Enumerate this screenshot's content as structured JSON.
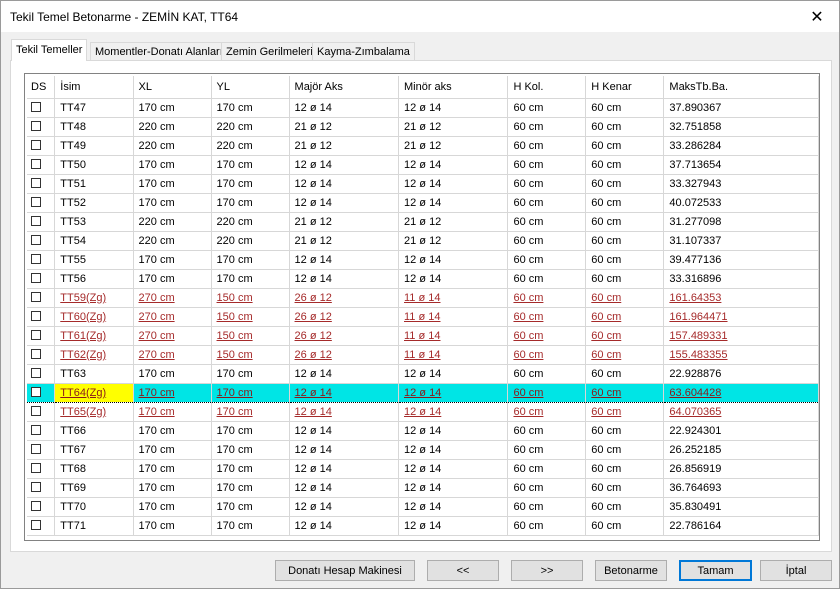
{
  "window": {
    "title": "Tekil Temel Betonarme - ZEMİN KAT, TT64",
    "close_glyph": "✕"
  },
  "tabs": [
    {
      "label": "Tekil Temeller"
    },
    {
      "label": "Momentler-Donatı Alanları"
    },
    {
      "label": "Zemin Gerilmeleri"
    },
    {
      "label": "Kayma-Zımbalama"
    }
  ],
  "table": {
    "columns": [
      "DS",
      "İsim",
      "XL",
      "YL",
      "Majör Aks",
      "Minör aks",
      "H Kol.",
      "H Kenar",
      "MaksTb.Ba."
    ],
    "rows": [
      {
        "name": "TT47",
        "xl": "170 cm",
        "yl": "170 cm",
        "major": "12 ø 14",
        "minor": "12 ø 14",
        "hkol": "60 cm",
        "hkenar": "60 cm",
        "maks": "37.890367"
      },
      {
        "name": "TT48",
        "xl": "220 cm",
        "yl": "220 cm",
        "major": "21 ø 12",
        "minor": "21 ø 12",
        "hkol": "60 cm",
        "hkenar": "60 cm",
        "maks": "32.751858"
      },
      {
        "name": "TT49",
        "xl": "220 cm",
        "yl": "220 cm",
        "major": "21 ø 12",
        "minor": "21 ø 12",
        "hkol": "60 cm",
        "hkenar": "60 cm",
        "maks": "33.286284"
      },
      {
        "name": "TT50",
        "xl": "170 cm",
        "yl": "170 cm",
        "major": "12 ø 14",
        "minor": "12 ø 14",
        "hkol": "60 cm",
        "hkenar": "60 cm",
        "maks": "37.713654"
      },
      {
        "name": "TT51",
        "xl": "170 cm",
        "yl": "170 cm",
        "major": "12 ø 14",
        "minor": "12 ø 14",
        "hkol": "60 cm",
        "hkenar": "60 cm",
        "maks": "33.327943"
      },
      {
        "name": "TT52",
        "xl": "170 cm",
        "yl": "170 cm",
        "major": "12 ø 14",
        "minor": "12 ø 14",
        "hkol": "60 cm",
        "hkenar": "60 cm",
        "maks": "40.072533"
      },
      {
        "name": "TT53",
        "xl": "220 cm",
        "yl": "220 cm",
        "major": "21 ø 12",
        "minor": "21 ø 12",
        "hkol": "60 cm",
        "hkenar": "60 cm",
        "maks": "31.277098"
      },
      {
        "name": "TT54",
        "xl": "220 cm",
        "yl": "220 cm",
        "major": "21 ø 12",
        "minor": "21 ø 12",
        "hkol": "60 cm",
        "hkenar": "60 cm",
        "maks": "31.107337"
      },
      {
        "name": "TT55",
        "xl": "170 cm",
        "yl": "170 cm",
        "major": "12 ø 14",
        "minor": "12 ø 14",
        "hkol": "60 cm",
        "hkenar": "60 cm",
        "maks": "39.477136"
      },
      {
        "name": "TT56",
        "xl": "170 cm",
        "yl": "170 cm",
        "major": "12 ø 14",
        "minor": "12 ø 14",
        "hkol": "60 cm",
        "hkenar": "60 cm",
        "maks": "33.316896"
      },
      {
        "name": "TT59(Zg)",
        "xl": "270 cm",
        "yl": "150 cm",
        "major": "26 ø 12",
        "minor": "11 ø 14",
        "hkol": "60 cm",
        "hkenar": "60 cm",
        "maks": "161.64353",
        "zg": true
      },
      {
        "name": "TT60(Zg)",
        "xl": "270 cm",
        "yl": "150 cm",
        "major": "26 ø 12",
        "minor": "11 ø 14",
        "hkol": "60 cm",
        "hkenar": "60 cm",
        "maks": "161.964471",
        "zg": true
      },
      {
        "name": "TT61(Zg)",
        "xl": "270 cm",
        "yl": "150 cm",
        "major": "26 ø 12",
        "minor": "11 ø 14",
        "hkol": "60 cm",
        "hkenar": "60 cm",
        "maks": "157.489331",
        "zg": true
      },
      {
        "name": "TT62(Zg)",
        "xl": "270 cm",
        "yl": "150 cm",
        "major": "26 ø 12",
        "minor": "11 ø 14",
        "hkol": "60 cm",
        "hkenar": "60 cm",
        "maks": "155.483355",
        "zg": true
      },
      {
        "name": "TT63",
        "xl": "170 cm",
        "yl": "170 cm",
        "major": "12 ø 14",
        "minor": "12 ø 14",
        "hkol": "60 cm",
        "hkenar": "60 cm",
        "maks": "22.928876"
      },
      {
        "name": "TT64(Zg)",
        "xl": "170 cm",
        "yl": "170 cm",
        "major": "12 ø 14",
        "minor": "12 ø 14",
        "hkol": "60 cm",
        "hkenar": "60 cm",
        "maks": "63.604428",
        "selected": true
      },
      {
        "name": "TT65(Zg)",
        "xl": "170 cm",
        "yl": "170 cm",
        "major": "12 ø 14",
        "minor": "12 ø 14",
        "hkol": "60 cm",
        "hkenar": "60 cm",
        "maks": "64.070365",
        "zg": true
      },
      {
        "name": "TT66",
        "xl": "170 cm",
        "yl": "170 cm",
        "major": "12 ø 14",
        "minor": "12 ø 14",
        "hkol": "60 cm",
        "hkenar": "60 cm",
        "maks": "22.924301"
      },
      {
        "name": "TT67",
        "xl": "170 cm",
        "yl": "170 cm",
        "major": "12 ø 14",
        "minor": "12 ø 14",
        "hkol": "60 cm",
        "hkenar": "60 cm",
        "maks": "26.252185"
      },
      {
        "name": "TT68",
        "xl": "170 cm",
        "yl": "170 cm",
        "major": "12 ø 14",
        "minor": "12 ø 14",
        "hkol": "60 cm",
        "hkenar": "60 cm",
        "maks": "26.856919"
      },
      {
        "name": "TT69",
        "xl": "170 cm",
        "yl": "170 cm",
        "major": "12 ø 14",
        "minor": "12 ø 14",
        "hkol": "60 cm",
        "hkenar": "60 cm",
        "maks": "36.764693"
      },
      {
        "name": "TT70",
        "xl": "170 cm",
        "yl": "170 cm",
        "major": "12 ø 14",
        "minor": "12 ø 14",
        "hkol": "60 cm",
        "hkenar": "60 cm",
        "maks": "35.830491"
      },
      {
        "name": "TT71",
        "xl": "170 cm",
        "yl": "170 cm",
        "major": "12 ø 14",
        "minor": "12 ø 14",
        "hkol": "60 cm",
        "hkenar": "60 cm",
        "maks": "22.786164"
      }
    ]
  },
  "buttons": {
    "calc": "Donatı Hesap Makinesi",
    "prev": "<<",
    "next": ">>",
    "betonarme": "Betonarme",
    "ok": "Tamam",
    "cancel": "İptal"
  },
  "colors": {
    "selected_row": "#00e5e5",
    "selected_name": "#ffff00",
    "zg_text": "#a52a2a"
  }
}
